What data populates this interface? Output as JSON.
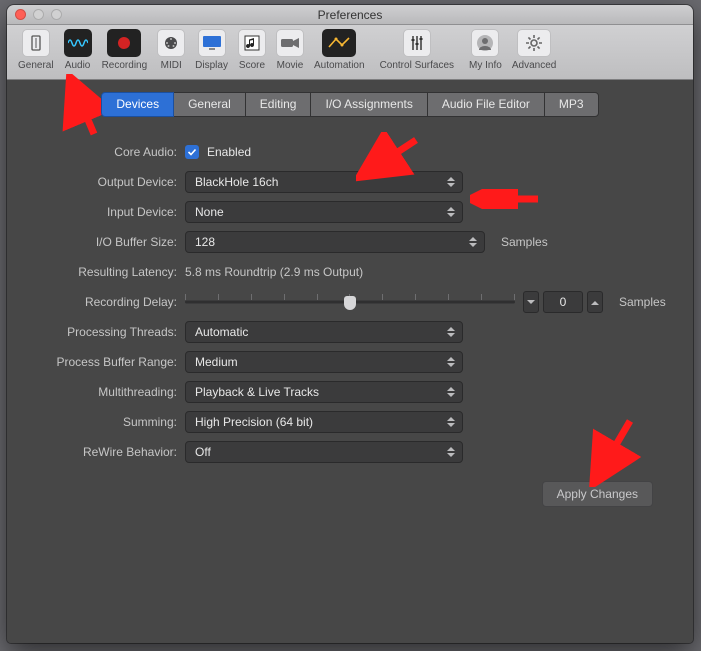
{
  "window": {
    "title": "Preferences"
  },
  "toolbar": {
    "items": [
      {
        "id": "general",
        "label": "General"
      },
      {
        "id": "audio",
        "label": "Audio"
      },
      {
        "id": "recording",
        "label": "Recording"
      },
      {
        "id": "midi",
        "label": "MIDI"
      },
      {
        "id": "display",
        "label": "Display"
      },
      {
        "id": "score",
        "label": "Score"
      },
      {
        "id": "movie",
        "label": "Movie"
      },
      {
        "id": "automation",
        "label": "Automation"
      },
      {
        "id": "ctlsurf",
        "label": "Control Surfaces"
      },
      {
        "id": "myinfo",
        "label": "My Info"
      },
      {
        "id": "advanced",
        "label": "Advanced"
      }
    ],
    "active": "audio"
  },
  "tabs": {
    "items": [
      {
        "id": "devices",
        "label": "Devices"
      },
      {
        "id": "general",
        "label": "General"
      },
      {
        "id": "editing",
        "label": "Editing"
      },
      {
        "id": "io",
        "label": "I/O Assignments"
      },
      {
        "id": "afe",
        "label": "Audio File Editor"
      },
      {
        "id": "mp3",
        "label": "MP3"
      }
    ],
    "active": "devices"
  },
  "form": {
    "core_audio": {
      "label": "Core Audio:",
      "enabled_text": "Enabled",
      "checked": true
    },
    "output_device": {
      "label": "Output Device:",
      "value": "BlackHole 16ch"
    },
    "input_device": {
      "label": "Input Device:",
      "value": "None"
    },
    "io_buffer": {
      "label": "I/O Buffer Size:",
      "value": "128",
      "unit": "Samples"
    },
    "resulting_latency": {
      "label": "Resulting Latency:",
      "value": "5.8 ms Roundtrip (2.9 ms Output)"
    },
    "recording_delay": {
      "label": "Recording Delay:",
      "value": "0",
      "unit": "Samples"
    },
    "processing_threads": {
      "label": "Processing Threads:",
      "value": "Automatic"
    },
    "process_buffer_range": {
      "label": "Process Buffer Range:",
      "value": "Medium"
    },
    "multithreading": {
      "label": "Multithreading:",
      "value": "Playback & Live Tracks"
    },
    "summing": {
      "label": "Summing:",
      "value": "High Precision (64 bit)"
    },
    "rewire_behavior": {
      "label": "ReWire Behavior:",
      "value": "Off"
    }
  },
  "buttons": {
    "apply_changes": "Apply Changes"
  }
}
